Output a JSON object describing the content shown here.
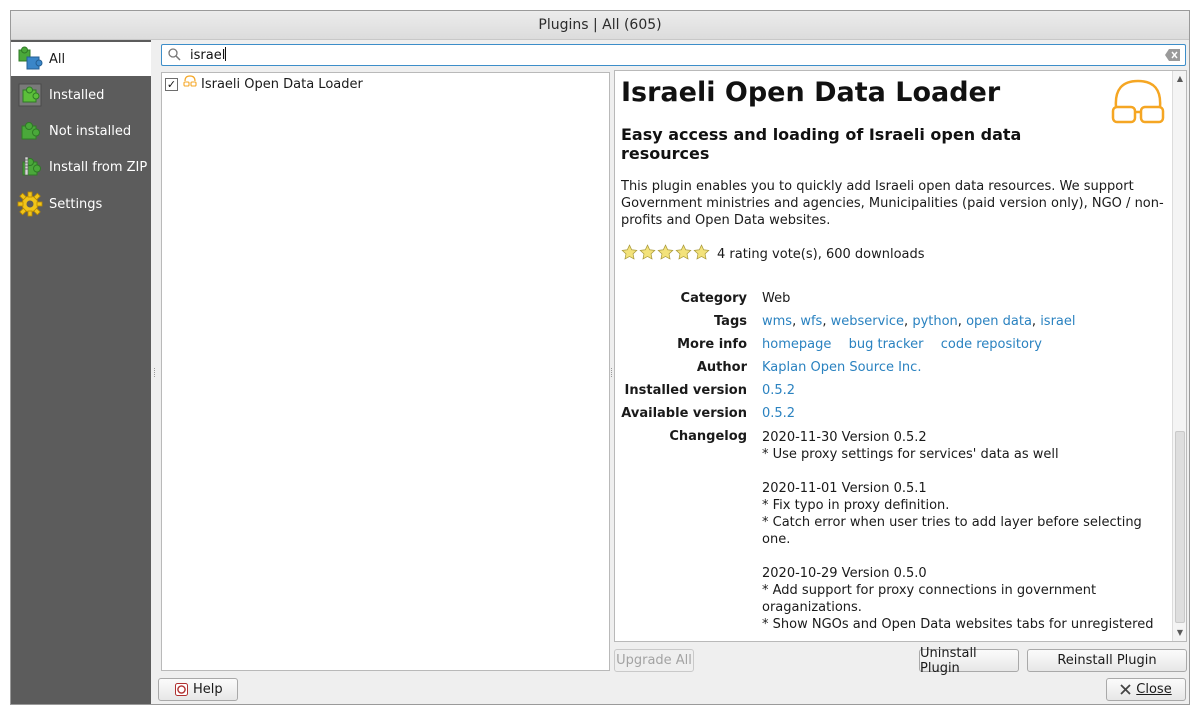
{
  "window": {
    "title": "Plugins | All (605)"
  },
  "sidebar": {
    "items": [
      {
        "label": "All",
        "icon": "puzzle-all-icon",
        "active": true
      },
      {
        "label": "Installed",
        "icon": "puzzle-installed-icon",
        "active": false
      },
      {
        "label": "Not installed",
        "icon": "puzzle-not-installed-icon",
        "active": false
      },
      {
        "label": "Install from ZIP",
        "icon": "zip-puzzle-icon",
        "active": false
      },
      {
        "label": "Settings",
        "icon": "gear-icon",
        "active": false
      }
    ]
  },
  "search": {
    "value": "israel",
    "placeholder": ""
  },
  "plugin_list": {
    "items": [
      {
        "label": "Israeli Open Data Loader",
        "checked": true
      }
    ]
  },
  "detail": {
    "title": "Israeli Open Data Loader",
    "subtitle": "Easy access and loading of Israeli open data resources",
    "description": "This plugin enables you to quickly add Israeli open data resources. We support Government ministries and agencies, Municipalities (paid version only), NGO / non-profits and Open Data websites.",
    "rating_text": "4 rating vote(s), 600 downloads",
    "stars": 5,
    "labels": {
      "category": "Category",
      "tags": "Tags",
      "more_info": "More info",
      "author": "Author",
      "installed_version": "Installed version",
      "available_version": "Available version",
      "changelog": "Changelog"
    },
    "category": "Web",
    "tags": [
      "wms",
      "wfs",
      "webservice",
      "python",
      "open data",
      "israel"
    ],
    "tag_sep": ", ",
    "more_info": [
      "homepage",
      "bug tracker",
      "code repository"
    ],
    "author": "Kaplan Open Source Inc.",
    "installed_version": "0.5.2",
    "available_version": "0.5.2",
    "changelog": "2020-11-30 Version 0.5.2\n* Use proxy settings for services' data as well\n\n2020-11-01 Version 0.5.1\n* Fix typo in proxy definition.\n* Catch error when user tries to add layer before selecting one.\n\n2020-10-29 Version 0.5.0\n* Add support for proxy connections in government oraganizations.\n* Show NGOs and Open Data websites tabs for unregistered"
  },
  "buttons": {
    "upgrade_all": "Upgrade All",
    "uninstall": "Uninstall Plugin",
    "reinstall": "Reinstall Plugin",
    "help": "Help",
    "close": "Close"
  },
  "colors": {
    "link": "#2a82c0",
    "sidebar_bg": "#5c5c5c",
    "search_border": "#3d8ec9",
    "logo": "#f5a623"
  }
}
